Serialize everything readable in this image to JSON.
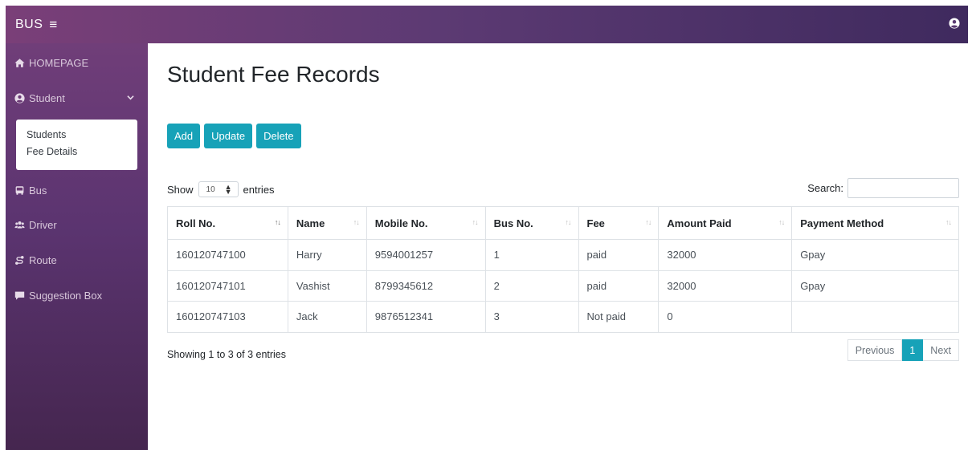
{
  "topbar": {
    "brand": "BUS",
    "menu_icon": "≡"
  },
  "sidebar": {
    "items": [
      {
        "label": "HOMEPAGE",
        "icon": "home-icon"
      },
      {
        "label": "Student",
        "icon": "user-circle-icon"
      },
      {
        "label": "Bus",
        "icon": "bus-icon"
      },
      {
        "label": "Driver",
        "icon": "users-icon"
      },
      {
        "label": "Route",
        "icon": "route-icon"
      },
      {
        "label": "Suggestion Box",
        "icon": "comment-icon"
      }
    ],
    "submenu": [
      "Students",
      "Fee Details"
    ]
  },
  "page": {
    "title": "Student Fee Records"
  },
  "actions": {
    "add": "Add",
    "update": "Update",
    "delete": "Delete"
  },
  "table_controls": {
    "show": "Show",
    "page_length": "10",
    "entries": "entries",
    "search_label": "Search:",
    "search_value": ""
  },
  "table": {
    "columns": [
      "Roll No.",
      "Name",
      "Mobile No.",
      "Bus No.",
      "Fee",
      "Amount Paid",
      "Payment Method"
    ],
    "rows": [
      [
        "160120747100",
        "Harry",
        "9594001257",
        "1",
        "paid",
        "32000",
        "Gpay"
      ],
      [
        "160120747101",
        "Vashist",
        "8799345612",
        "2",
        "paid",
        "32000",
        "Gpay"
      ],
      [
        "160120747103",
        "Jack",
        "9876512341",
        "3",
        "Not paid",
        "0",
        ""
      ]
    ]
  },
  "footer": {
    "info": "Showing 1 to 3 of 3 entries",
    "previous": "Previous",
    "current_page": "1",
    "next": "Next"
  },
  "colors": {
    "accent": "#17a2b8",
    "sidebar_top": "#703e79",
    "topbar_end": "#3f2a5e"
  }
}
